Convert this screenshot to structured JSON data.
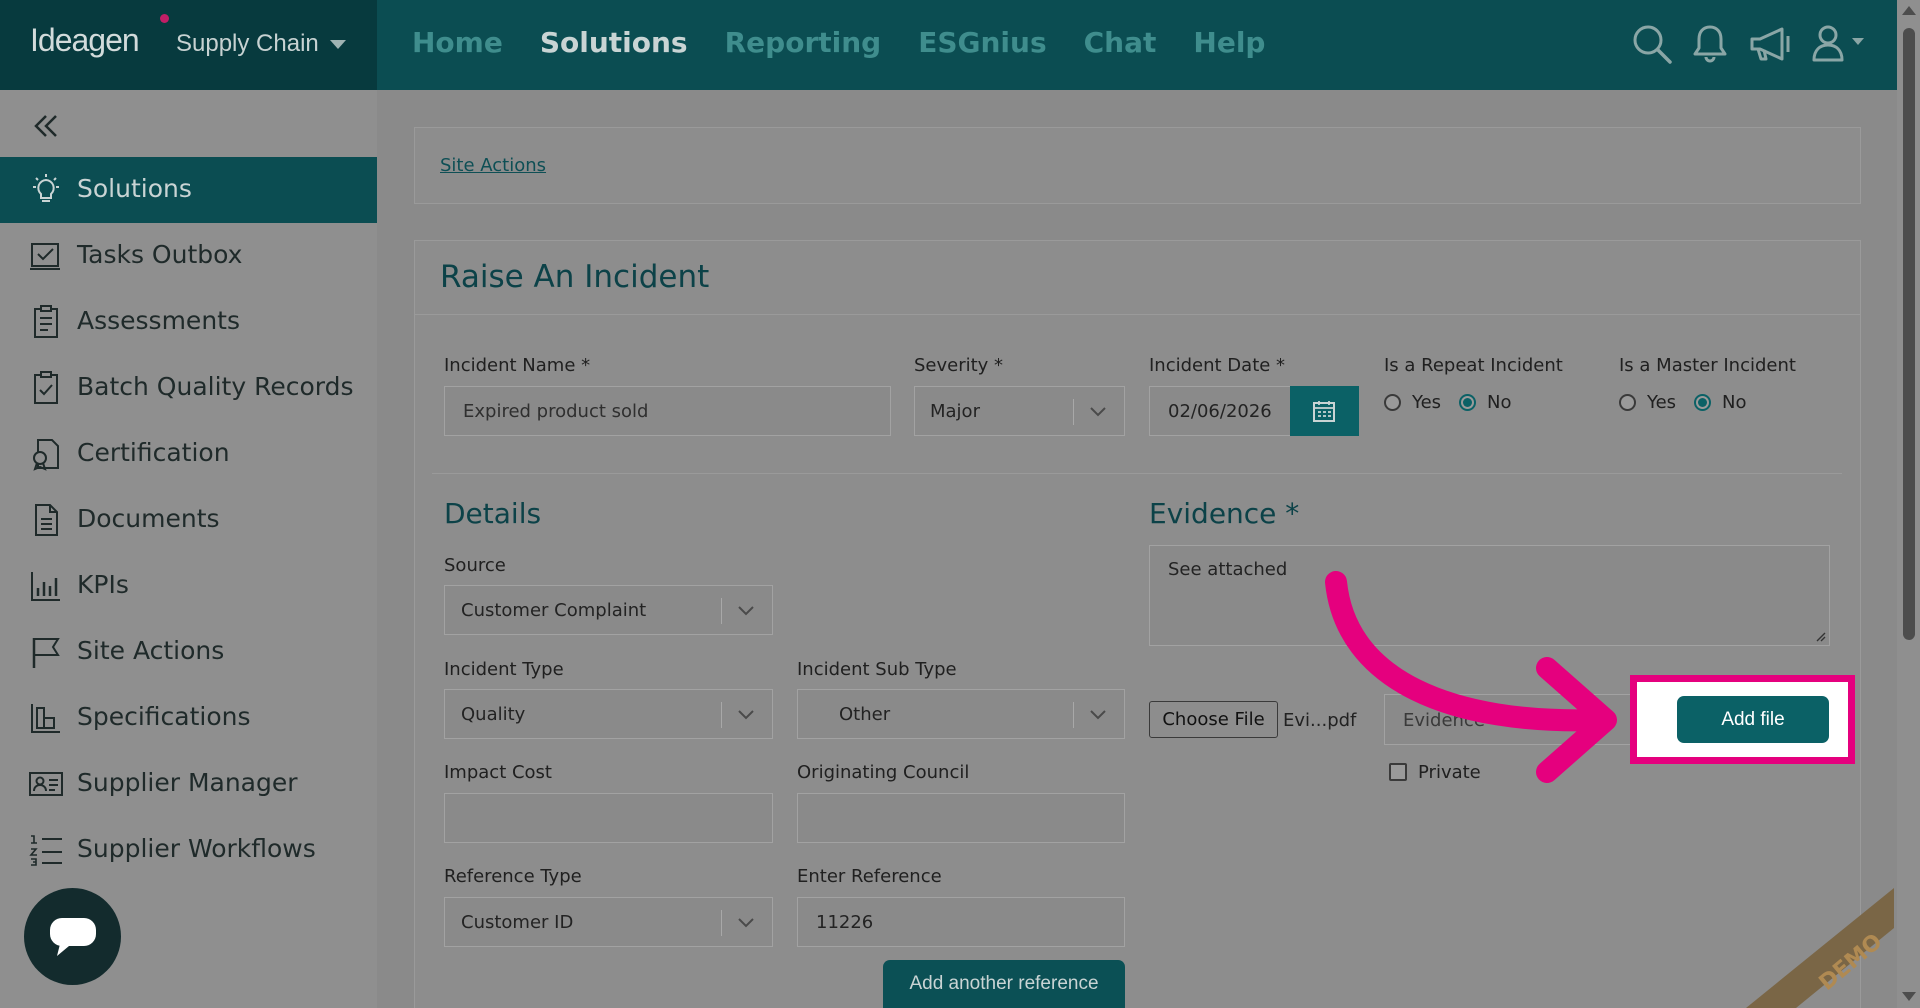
{
  "header": {
    "logo_text": "Ideagen",
    "product": "Supply Chain",
    "nav": [
      {
        "label": "Home"
      },
      {
        "label": "Solutions"
      },
      {
        "label": "Reporting"
      },
      {
        "label": "ESGnius"
      },
      {
        "label": "Chat"
      },
      {
        "label": "Help"
      }
    ],
    "active_nav": "Solutions",
    "icons": [
      "search-icon",
      "bell-icon",
      "megaphone-icon",
      "user-icon"
    ]
  },
  "sidebar": {
    "items": [
      {
        "label": "Solutions",
        "icon": "lightbulb-icon",
        "active": true
      },
      {
        "label": "Tasks Outbox",
        "icon": "tasks-outbox-icon"
      },
      {
        "label": "Assessments",
        "icon": "clipboard-icon"
      },
      {
        "label": "Batch Quality Records",
        "icon": "clipboard-check-icon"
      },
      {
        "label": "Certification",
        "icon": "certificate-icon"
      },
      {
        "label": "Documents",
        "icon": "document-icon"
      },
      {
        "label": "KPIs",
        "icon": "bar-chart-icon"
      },
      {
        "label": "Site Actions",
        "icon": "flag-icon"
      },
      {
        "label": "Specifications",
        "icon": "specifications-icon"
      },
      {
        "label": "Supplier Manager",
        "icon": "contact-card-icon"
      },
      {
        "label": "Supplier Workflows",
        "icon": "numbered-list-icon"
      }
    ]
  },
  "breadcrumb": {
    "link": "Site Actions"
  },
  "form": {
    "title": "Raise An Incident",
    "incident_name": {
      "label": "Incident Name *",
      "value": "Expired product sold"
    },
    "severity": {
      "label": "Severity *",
      "value": "Major"
    },
    "incident_date": {
      "label": "Incident Date *",
      "value": "02/06/2026"
    },
    "repeat": {
      "label": "Is a Repeat Incident",
      "yes": "Yes",
      "no": "No",
      "selected": "No"
    },
    "master": {
      "label": "Is a Master Incident",
      "yes": "Yes",
      "no": "No",
      "selected": "No"
    },
    "details": {
      "heading": "Details",
      "source": {
        "label": "Source",
        "value": "Customer Complaint"
      },
      "incident_type": {
        "label": "Incident Type",
        "value": "Quality"
      },
      "incident_sub_type": {
        "label": "Incident Sub Type",
        "value": "Other"
      },
      "impact_cost": {
        "label": "Impact Cost",
        "value": ""
      },
      "originating_council": {
        "label": "Originating Council",
        "value": ""
      },
      "reference_type": {
        "label": "Reference Type",
        "value": "Customer ID"
      },
      "enter_reference": {
        "label": "Enter Reference",
        "value": "11226"
      },
      "add_reference": "Add another reference"
    },
    "evidence": {
      "heading": "Evidence *",
      "text": "See attached",
      "choose_file": "Choose File",
      "chosen_file": "Evi...pdf",
      "name_input": "Evidence",
      "private_label": "Private",
      "private_checked": false,
      "add_file": "Add file"
    }
  },
  "watermark": "DEMO",
  "colors": {
    "brand": "#0b4d52",
    "accent": "#0b6166",
    "highlight": "#e5007e"
  }
}
